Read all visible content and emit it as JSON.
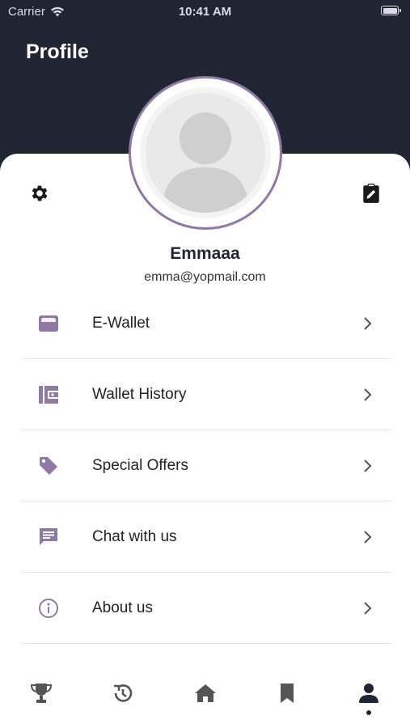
{
  "status_bar": {
    "carrier": "Carrier",
    "time": "10:41 AM"
  },
  "header": {
    "title": "Profile"
  },
  "profile": {
    "name": "Emmaaa",
    "email": "emma@yopmail.com"
  },
  "menu": {
    "items": [
      {
        "label": "E-Wallet",
        "icon": "wallet-icon"
      },
      {
        "label": "Wallet History",
        "icon": "wallet-history-icon"
      },
      {
        "label": "Special Offers",
        "icon": "tag-icon"
      },
      {
        "label": "Chat with us",
        "icon": "chat-icon"
      },
      {
        "label": "About us",
        "icon": "info-icon"
      }
    ]
  },
  "tabbar": {
    "tabs": [
      {
        "name": "trophy",
        "icon": "trophy-icon"
      },
      {
        "name": "history",
        "icon": "history-icon"
      },
      {
        "name": "home",
        "icon": "home-icon"
      },
      {
        "name": "bookmark",
        "icon": "bookmark-icon"
      },
      {
        "name": "profile",
        "icon": "person-icon",
        "active": true
      }
    ]
  },
  "colors": {
    "header": "#1f2533",
    "accent": "#8e7aa5",
    "icon_gray": "#555555",
    "active": "#1f2533"
  }
}
